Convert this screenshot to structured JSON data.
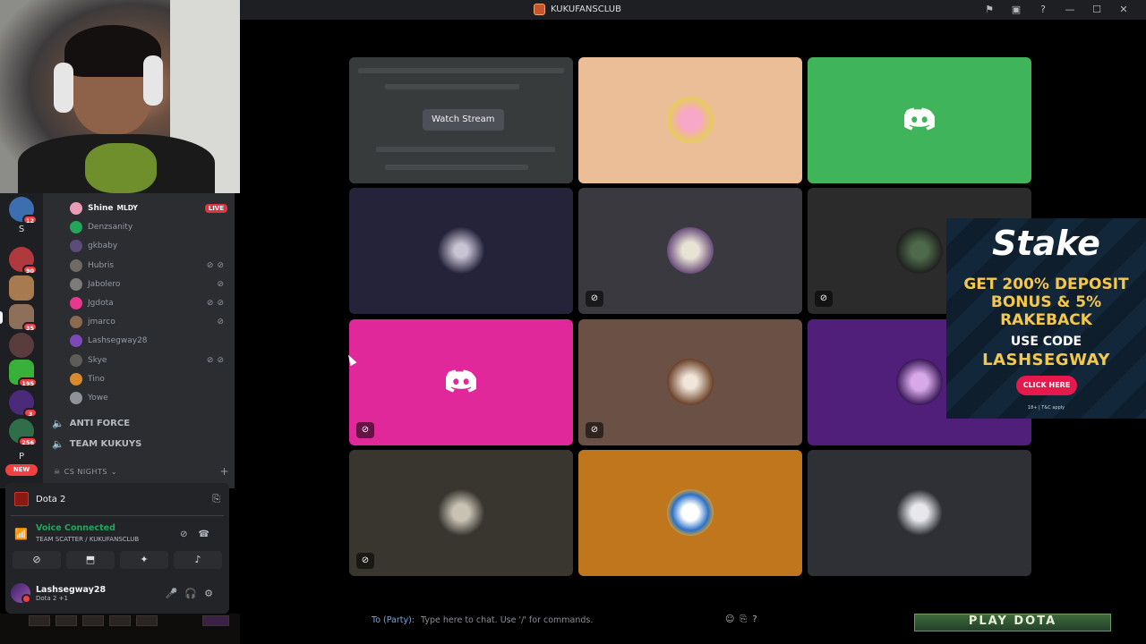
{
  "titlebar": {
    "title": "KUKUFANSCLUB",
    "icons": [
      "flag-icon",
      "inbox-icon",
      "help-icon",
      "minimize-icon",
      "maximize-icon",
      "close-icon"
    ]
  },
  "rail": {
    "badges": [
      "12",
      "90",
      "35",
      "195",
      "3",
      "256"
    ],
    "letters": [
      "S",
      "P"
    ],
    "new_label": "NEW"
  },
  "voice_users": [
    {
      "name": "Shine",
      "tag": "MLDY",
      "live": "LIVE"
    },
    {
      "name": "Denzsanity"
    },
    {
      "name": "gkbaby"
    },
    {
      "name": "Hubris"
    },
    {
      "name": "Jabolero"
    },
    {
      "name": "Jgdota"
    },
    {
      "name": "jmarco"
    },
    {
      "name": "Lashsegway28"
    },
    {
      "name": "Skye"
    },
    {
      "name": "Tino"
    },
    {
      "name": "Yowe"
    }
  ],
  "voice_channels": [
    {
      "name": "ANTI FORCE"
    },
    {
      "name": "TEAM KUKUYS"
    }
  ],
  "category": {
    "name": "CS NIGHTS"
  },
  "activity": {
    "game": "Dota 2"
  },
  "voice_status": {
    "status": "Voice Connected",
    "location": "TEAM SCATTER / KUKUFANSCLUB"
  },
  "user": {
    "name": "Lashsegway28",
    "status": "Dota 2 +1"
  },
  "stage": {
    "watch_label": "Watch Stream"
  },
  "ad": {
    "brand": "Stake",
    "line1": "GET 200% DEPOSIT",
    "line2": "BONUS & 5%",
    "line3": "RAKEBACK",
    "code_label": "USE CODE",
    "code": "LASHSEGWAY",
    "cta": "CLICK HERE",
    "fine": "18+ | T&C apply"
  },
  "chat": {
    "to": "To (Party):",
    "placeholder": "Type here to chat. Use '/' for commands."
  },
  "play_button": "PLAY DOTA"
}
